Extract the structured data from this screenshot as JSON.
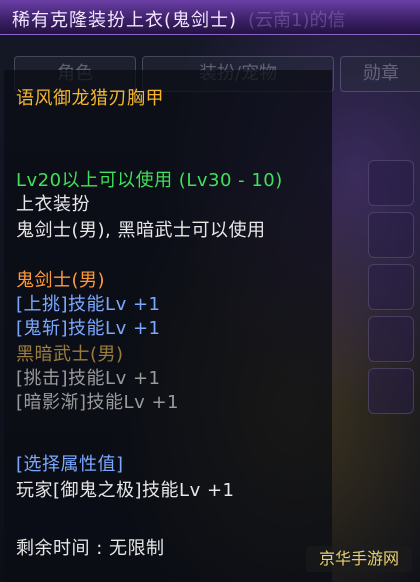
{
  "window": {
    "title": "稀有克隆装扮上衣(鬼剑士)",
    "title_ghost": "(云南1)的信"
  },
  "tabs": [
    {
      "label": "角色"
    },
    {
      "label": "装扮/宠物"
    },
    {
      "label": "勋章"
    }
  ],
  "tooltip": {
    "item_name": "语风御龙猎刃胸甲",
    "level_req": "Lv20以上可以使用 (Lv30 - 10)",
    "slot_type": "上衣装扮",
    "usable_by": "鬼剑士(男), 黑暗武士可以使用",
    "class1_name": "鬼剑士(男)",
    "class1_skill1": "[上挑]技能Lv +1",
    "class1_skill2": "[鬼斩]技能Lv +1",
    "class2_name": "黑暗武士(男)",
    "class2_skill1": "[挑击]技能Lv +1",
    "class2_skill2": "[暗影渐]技能Lv +1",
    "select_attr": "[选择属性值]",
    "player_skill": "玩家[御鬼之极]技能Lv +1",
    "time_left": "剩余时间 : 无限制"
  },
  "watermark": "京华手游网",
  "colors": {
    "title_bar": "#6a3fa6",
    "item_name": "#f5b62d",
    "level_req": "#3fe05a",
    "class_active": "#ff9a3b",
    "skill_active": "#7aa8ff",
    "class_inactive": "#9b7c3d",
    "skill_inactive": "#9a9a9a"
  }
}
